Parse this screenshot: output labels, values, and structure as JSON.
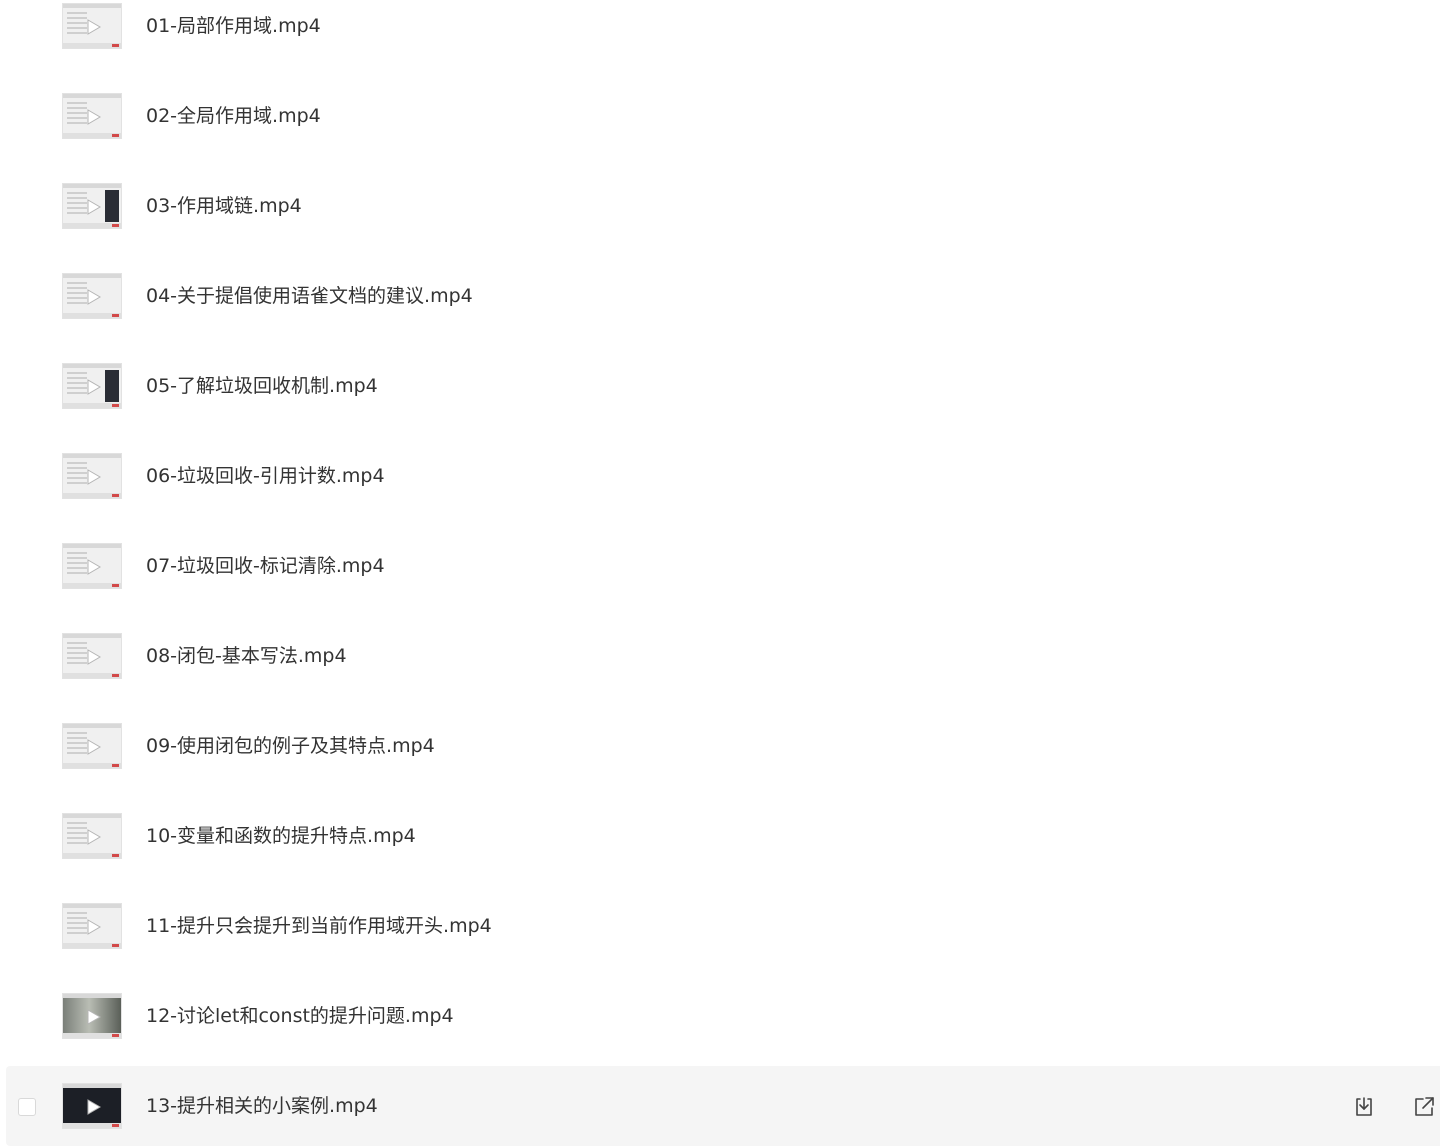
{
  "files": [
    {
      "name": "01-局部作用域.mp4",
      "thumb": "light"
    },
    {
      "name": "02-全局作用域.mp4",
      "thumb": "light"
    },
    {
      "name": "03-作用域链.mp4",
      "thumb": "mixed"
    },
    {
      "name": "04-关于提倡使用语雀文档的建议.mp4",
      "thumb": "light"
    },
    {
      "name": "05-了解垃圾回收机制.mp4",
      "thumb": "mixed"
    },
    {
      "name": "06-垃圾回收-引用计数.mp4",
      "thumb": "light"
    },
    {
      "name": "07-垃圾回收-标记清除.mp4",
      "thumb": "light"
    },
    {
      "name": "08-闭包-基本写法.mp4",
      "thumb": "light"
    },
    {
      "name": "09-使用闭包的例子及其特点.mp4",
      "thumb": "light"
    },
    {
      "name": "10-变量和函数的提升特点.mp4",
      "thumb": "light"
    },
    {
      "name": "11-提升只会提升到当前作用域开头.mp4",
      "thumb": "light"
    },
    {
      "name": "12-讨论let和const的提升问题.mp4",
      "thumb": "photo"
    },
    {
      "name": "13-提升相关的小案例.mp4",
      "thumb": "dark"
    }
  ],
  "hovered_index": 12,
  "icons": {
    "play": "play-icon",
    "download": "download-icon",
    "share": "external-link-icon"
  },
  "colors": {
    "text": "#333333",
    "row_hover": "#f5f5f5",
    "accent_red": "#d24a4a"
  }
}
